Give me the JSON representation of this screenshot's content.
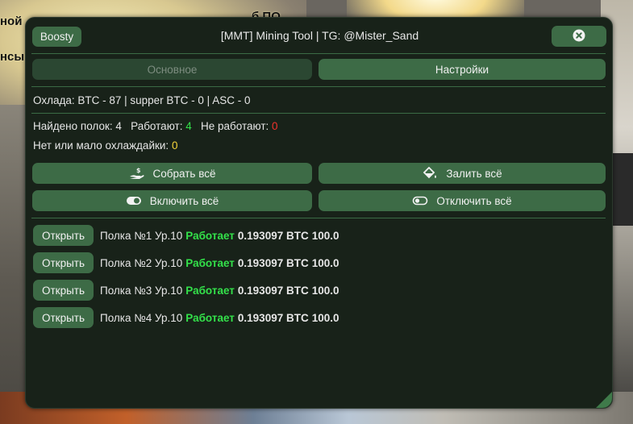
{
  "background": {
    "text_line1": "ной",
    "text_line2": "нсы",
    "text_top": "б    ПО"
  },
  "window": {
    "title": "[MMT] Mining Tool | TG: @Mister_Sand",
    "boosty_label": "Boosty",
    "close_icon": "close-icon"
  },
  "tabs": [
    {
      "label": "Основное",
      "active": false
    },
    {
      "label": "Настройки",
      "active": true
    }
  ],
  "cooling_line": "Охлада: BTC - 87 | supper BTC - 0 | ASC - 0",
  "stats": {
    "found_label": "Найдено полок: 4",
    "working_label": "Работают:",
    "working_value": "4",
    "not_working_label": "Не работают:",
    "not_working_value": "0",
    "low_cool_label": "Нет или мало охлаждайки:",
    "low_cool_value": "0"
  },
  "actions": {
    "collect_all": "Собрать всё",
    "fill_all": "Залить всё",
    "enable_all": "Включить всё",
    "disable_all": "Отключить всё"
  },
  "shelves": [
    {
      "open_label": "Открыть",
      "name": "Полка №1 Ур.10",
      "status": "Работает",
      "amount": "0.193097 BTC",
      "percent": "100.0"
    },
    {
      "open_label": "Открыть",
      "name": "Полка №2 Ур.10",
      "status": "Работает",
      "amount": "0.193097 BTC",
      "percent": "100.0"
    },
    {
      "open_label": "Открыть",
      "name": "Полка №3 Ур.10",
      "status": "Работает",
      "amount": "0.193097 BTC",
      "percent": "100.0"
    },
    {
      "open_label": "Открыть",
      "name": "Полка №4 Ур.10",
      "status": "Работает",
      "amount": "0.193097 BTC",
      "percent": "100.0"
    }
  ],
  "colors": {
    "button": "#3d6b46",
    "window_bg": "#182219",
    "working": "#33e14a",
    "error": "#f0322c",
    "warning": "#f4d43a"
  }
}
